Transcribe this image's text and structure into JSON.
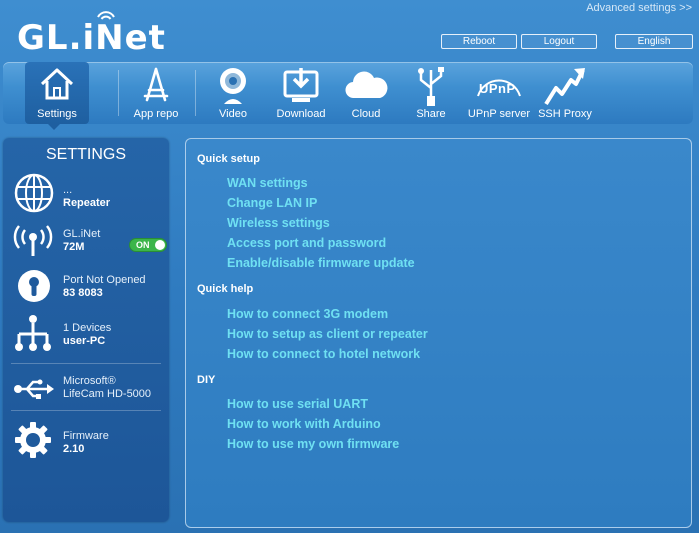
{
  "header": {
    "logo_text": "GL.iNet",
    "advanced_link": "Advanced settings >>",
    "reboot_label": "Reboot",
    "logout_label": "Logout",
    "language_label": "English"
  },
  "nav": {
    "items": [
      {
        "label": "Settings",
        "icon": "house-icon"
      },
      {
        "label": "App repo",
        "icon": "app-repo-icon"
      },
      {
        "label": "Video",
        "icon": "webcam-icon"
      },
      {
        "label": "Download",
        "icon": "download-icon"
      },
      {
        "label": "Cloud",
        "icon": "cloud-icon"
      },
      {
        "label": "Share",
        "icon": "usb-share-icon"
      },
      {
        "label": "UPnP server",
        "icon": "upnp-icon"
      },
      {
        "label": "SSH Proxy",
        "icon": "ssh-proxy-icon"
      }
    ],
    "upnp_badge": "UPnP"
  },
  "sidebar": {
    "title": "SETTINGS",
    "internet": {
      "line1": "...",
      "line2": "Repeater"
    },
    "wifi": {
      "line1": "GL.iNet",
      "line2": "72M",
      "toggle": "ON"
    },
    "port": {
      "line1": "Port Not Opened",
      "line2": "83 8083"
    },
    "devices": {
      "line1": "1 Devices",
      "line2": "user-PC"
    },
    "usb": {
      "line1": "Microsoft®",
      "line2": "LifeCam HD-5000"
    },
    "firmware": {
      "line1": "Firmware",
      "line2": "2.10"
    }
  },
  "main": {
    "quick_setup": {
      "title": "Quick setup",
      "links": [
        "WAN settings",
        "Change LAN IP",
        "Wireless settings",
        "Access port and password",
        "Enable/disable firmware update"
      ]
    },
    "quick_help": {
      "title": "Quick help",
      "links": [
        "How to connect 3G modem",
        "How to setup as client or repeater",
        "How to connect to hotel network"
      ]
    },
    "diy": {
      "title": "DIY",
      "links": [
        "How to use serial UART",
        "How to work with Arduino",
        "How to use my own firmware"
      ]
    }
  },
  "colors": {
    "background": "#2f7bc0",
    "link": "#6fe0f2",
    "toggle_on": "#3cb54a"
  }
}
